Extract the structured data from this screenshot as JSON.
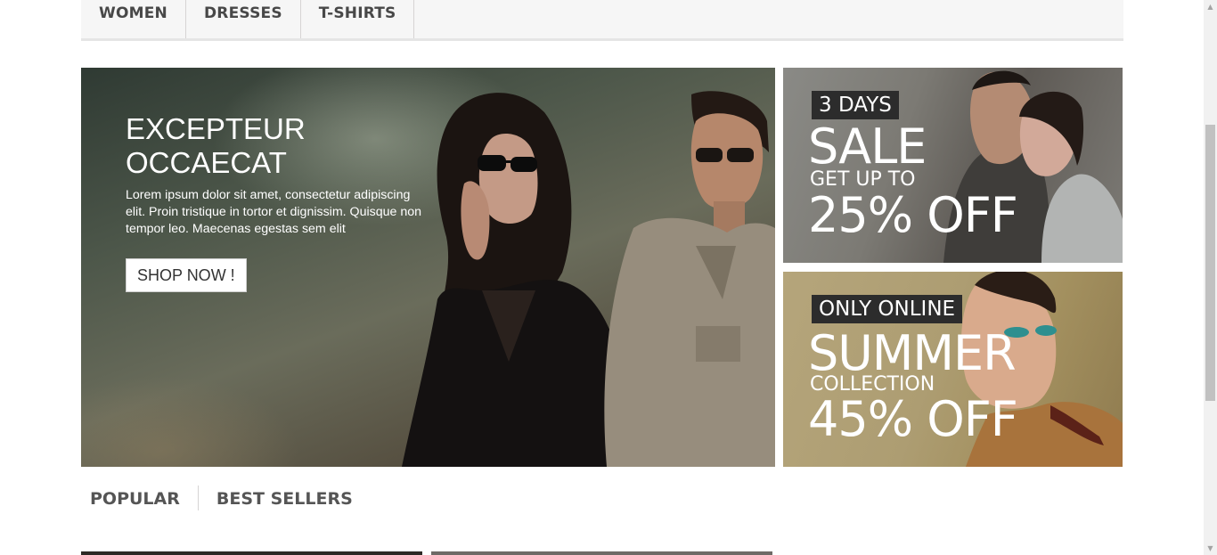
{
  "nav": {
    "items": [
      {
        "label": "WOMEN"
      },
      {
        "label": "DRESSES"
      },
      {
        "label": "T-SHIRTS"
      }
    ]
  },
  "hero": {
    "title": "EXCEPTEUR OCCAECAT",
    "text": "Lorem ipsum dolor sit amet, consectetur adipiscing elit. Proin tristique in tortor et dignissim. Quisque non tempor leo. Maecenas egestas sem elit",
    "button": "SHOP NOW !"
  },
  "promos": [
    {
      "tag": "3 DAYS",
      "big": "SALE",
      "mid": "GET UP TO",
      "off": "25% OFF"
    },
    {
      "tag": "ONLY ONLINE",
      "big": "SUMMER",
      "mid": "COLLECTION",
      "off": "45% OFF"
    }
  ],
  "tabs": [
    {
      "label": "POPULAR"
    },
    {
      "label": "BEST SELLERS"
    }
  ],
  "icons": {
    "scroll_up": "triangle-up-icon",
    "scroll_down": "triangle-down-icon"
  }
}
